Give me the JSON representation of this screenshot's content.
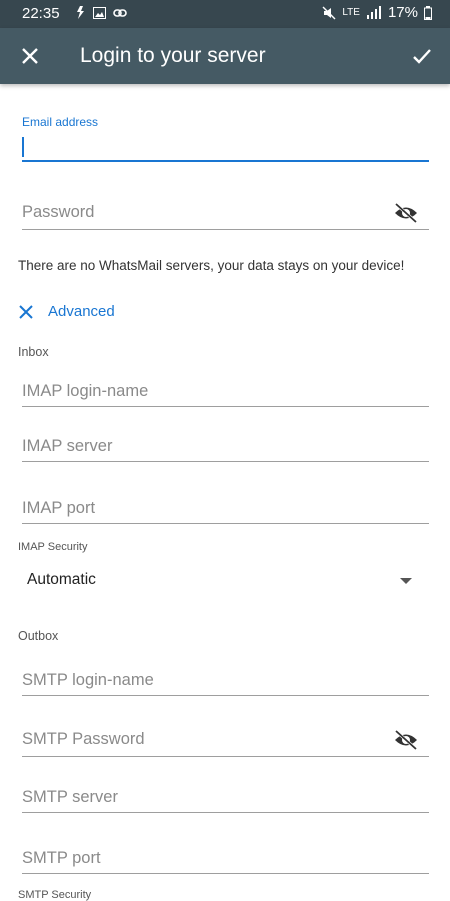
{
  "status_bar": {
    "time": "22:35",
    "battery": "17%",
    "network": "LTE"
  },
  "app_bar": {
    "title": "Login to your server"
  },
  "form": {
    "email_label": "Email address",
    "password_placeholder": "Password",
    "info_text": "There are no WhatsMail servers, your data stays on your device!",
    "advanced_label": "Advanced",
    "inbox_label": "Inbox",
    "imap_login_placeholder": "IMAP login-name",
    "imap_server_placeholder": "IMAP server",
    "imap_port_placeholder": "IMAP port",
    "imap_security_label": "IMAP Security",
    "imap_security_value": "Automatic",
    "outbox_label": "Outbox",
    "smtp_login_placeholder": "SMTP login-name",
    "smtp_password_placeholder": "SMTP Password",
    "smtp_server_placeholder": "SMTP server",
    "smtp_port_placeholder": "SMTP port",
    "smtp_security_label": "SMTP Security"
  },
  "colors": {
    "app_bar": "#455a64",
    "status_bar": "#37474f",
    "accent": "#1976d2"
  }
}
